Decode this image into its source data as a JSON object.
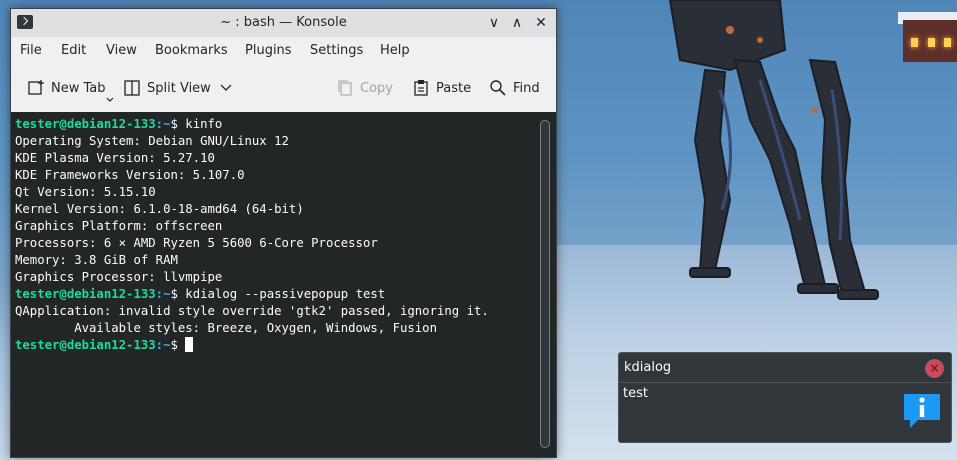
{
  "window": {
    "title": "~ : bash — Konsole",
    "minimize_glyph": "∨",
    "maximize_glyph": "∧",
    "close_glyph": "✕"
  },
  "menu": [
    "File",
    "Edit",
    "View",
    "Bookmarks",
    "Plugins",
    "Settings",
    "Help"
  ],
  "toolbar": {
    "new_tab": "New Tab",
    "split_view": "Split View",
    "copy": "Copy",
    "paste": "Paste",
    "find": "Find"
  },
  "terminal": {
    "prompt_user": "tester@debian12-133",
    "prompt_path": ":~",
    "prompt_symbol": "$ ",
    "cmd1": "kinfo",
    "info": [
      "Operating System: Debian GNU/Linux 12",
      "KDE Plasma Version: 5.27.10",
      "KDE Frameworks Version: 5.107.0",
      "Qt Version: 5.15.10",
      "Kernel Version: 6.1.0-18-amd64 (64-bit)",
      "Graphics Platform: offscreen",
      "Processors: 6 × AMD Ryzen 5 5600 6-Core Processor",
      "Memory: 3.8 GiB of RAM",
      "Graphics Processor: llvmpipe"
    ],
    "cmd2": "kdialog --passivepopup test",
    "warn1": "QApplication: invalid style override 'gtk2' passed, ignoring it.",
    "warn2": "        Available styles: Breeze, Oxygen, Windows, Fusion"
  },
  "popup": {
    "title": "kdialog",
    "message": "test",
    "close_glyph": "×"
  },
  "colors": {
    "terminal_bg": "#232627",
    "prompt_user": "#1cdc9a",
    "prompt_path": "#3daee9",
    "popup_bg": "#31363b",
    "close_red": "#da4453",
    "info_icon_blue": "#1d99f3"
  },
  "icons": [
    "konsole-icon",
    "new-tab-icon",
    "split-view-icon",
    "chevron-down-icon",
    "copy-icon",
    "paste-icon",
    "search-icon",
    "close-icon",
    "information-icon"
  ]
}
